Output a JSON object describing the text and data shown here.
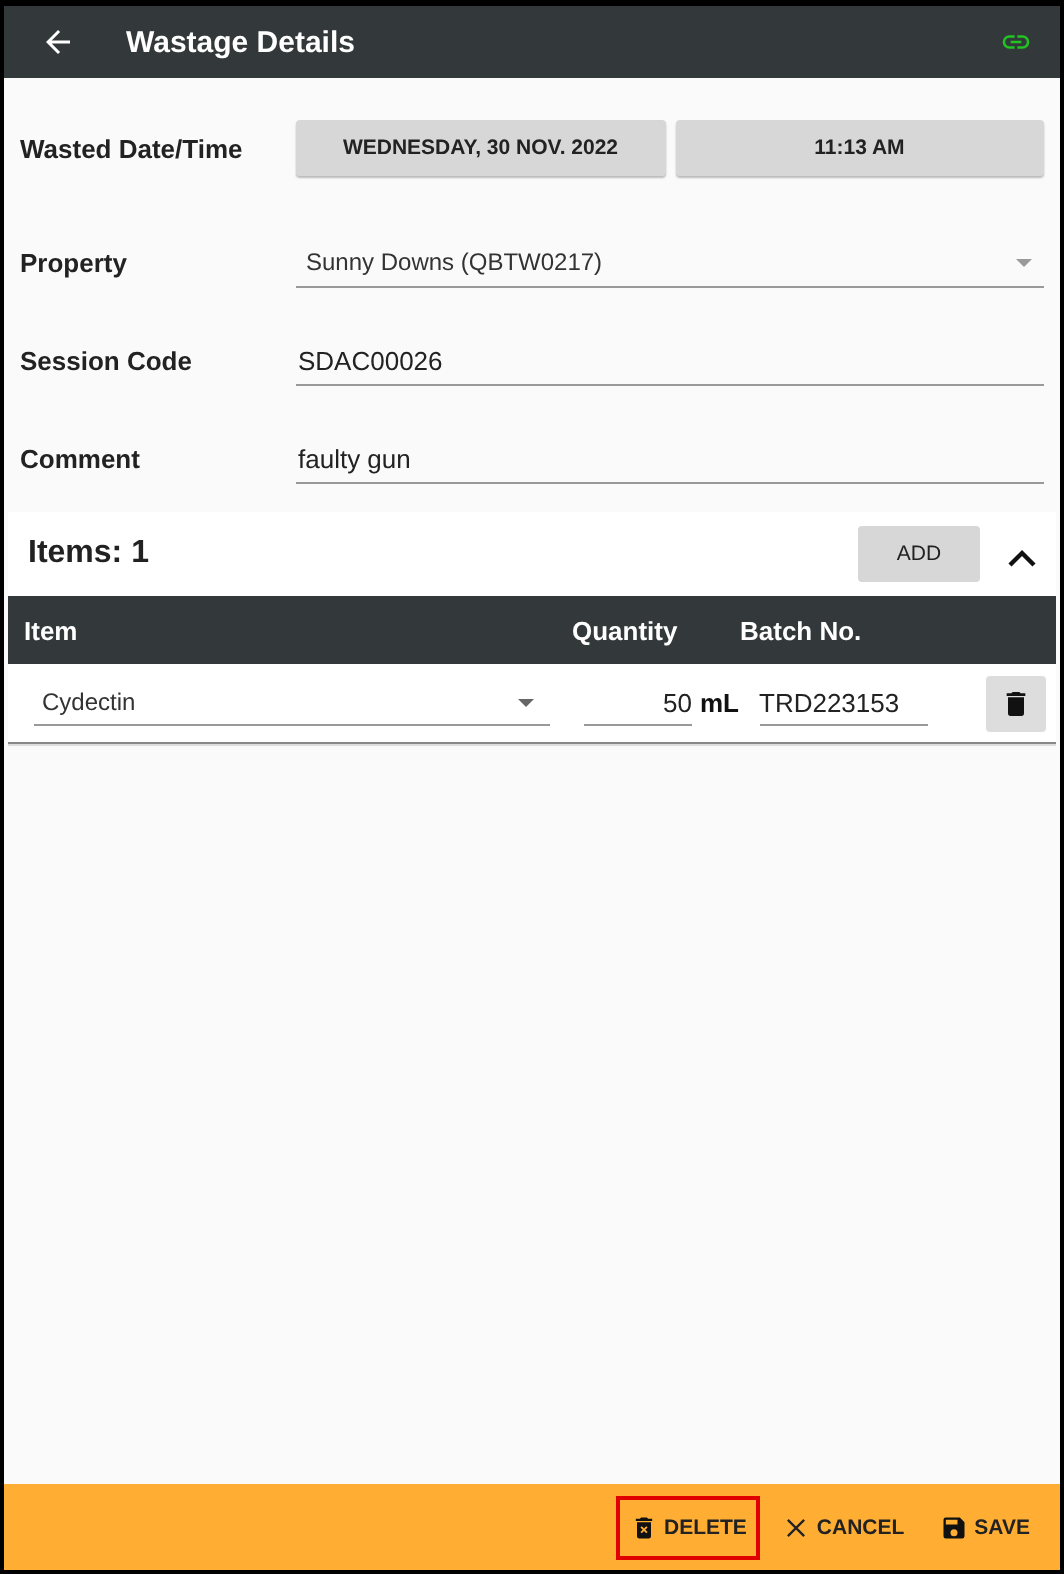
{
  "app_bar": {
    "title": "Wastage Details"
  },
  "form": [
    {
      "kind": "buttons",
      "label": "Wasted Date/Time",
      "values": [
        "WEDNESDAY, 30 NOV. 2022",
        "11:13 AM"
      ]
    },
    {
      "kind": "select",
      "label": "Property",
      "value": "Sunny Downs (QBTW0217)"
    },
    {
      "kind": "text",
      "label": "Session Code",
      "value": "SDAC00026"
    },
    {
      "kind": "text",
      "label": "Comment",
      "value": "faulty gun"
    }
  ],
  "items": {
    "title": "Items: 1",
    "add_button": "ADD",
    "expanded": true,
    "columns": [
      "Item",
      "Quantity",
      "Batch No."
    ],
    "rows": [
      {
        "item": "Cydectin",
        "quantity": "50",
        "unit": "mL",
        "batch": "TRD223153"
      }
    ]
  },
  "actions": [
    {
      "kind": "delete",
      "label": "DELETE",
      "highlighted": true
    },
    {
      "kind": "cancel",
      "label": "CANCEL",
      "highlighted": false
    },
    {
      "kind": "save",
      "label": "SAVE",
      "highlighted": false
    }
  ]
}
